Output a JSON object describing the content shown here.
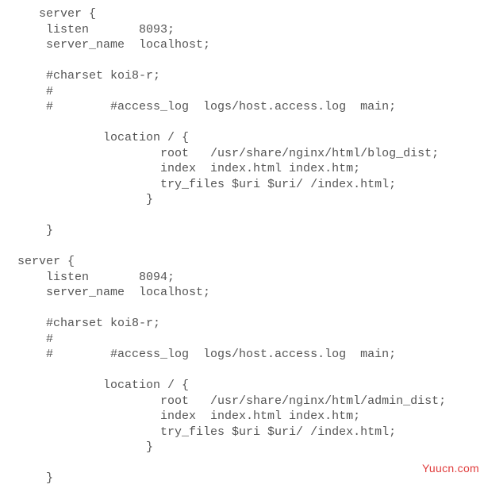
{
  "code": {
    "lines": [
      "     server {",
      "      listen       8093;",
      "      server_name  localhost;",
      "",
      "      #charset koi8-r;",
      "      #",
      "      #        #access_log  logs/host.access.log  main;",
      "",
      "              location / {",
      "                      root   /usr/share/nginx/html/blog_dist;",
      "                      index  index.html index.htm;",
      "                      try_files $uri $uri/ /index.html;",
      "                    }",
      "",
      "      }",
      "",
      "  server {",
      "      listen       8094;",
      "      server_name  localhost;",
      "",
      "      #charset koi8-r;",
      "      #",
      "      #        #access_log  logs/host.access.log  main;",
      "",
      "              location / {",
      "                      root   /usr/share/nginx/html/admin_dist;",
      "                      index  index.html index.htm;",
      "                      try_files $uri $uri/ /index.html;",
      "                    }",
      "",
      "      }"
    ]
  },
  "watermark": {
    "text": "Yuucn.com"
  }
}
